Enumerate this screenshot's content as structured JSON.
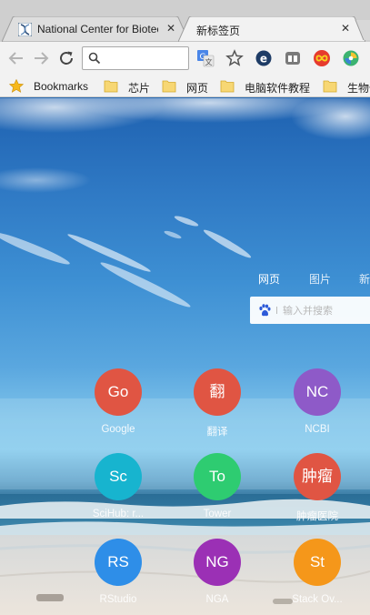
{
  "tabs": [
    {
      "title": "National Center for Biotechnology Information",
      "favicon": "ncbi-helix-icon",
      "close": "✕"
    },
    {
      "title": "新标签页",
      "close": "✕"
    }
  ],
  "toolbar": {
    "back": "back-arrow-icon",
    "forward": "forward-arrow-icon",
    "reload": "reload-icon",
    "omnibox_value": "",
    "extensions": [
      "translate-icon",
      "star-icon",
      "extension-e-icon",
      "extension-window-icon",
      "extension-infinity-icon",
      "extension-swirl-icon"
    ]
  },
  "bookmarks": [
    {
      "label": "Bookmarks",
      "icon": "star-bookmark-icon"
    },
    {
      "label": "芯片",
      "icon": "folder-icon"
    },
    {
      "label": "网页",
      "icon": "folder-icon"
    },
    {
      "label": "电脑软件教程",
      "icon": "folder-icon"
    },
    {
      "label": "生物信息",
      "icon": "folder-icon"
    }
  ],
  "ntp": {
    "search_tabs": [
      "网页",
      "图片",
      "新闻"
    ],
    "search_placeholder": "输入并搜索",
    "tiles": [
      {
        "abbr": "Go",
        "label": "Google",
        "color": "#e05543"
      },
      {
        "abbr": "翻",
        "label": "翻译",
        "color": "#e05543"
      },
      {
        "abbr": "NC",
        "label": "NCBI",
        "color": "#8e5ac8"
      },
      {
        "abbr": "Sc",
        "label": "SciHub: r...",
        "color": "#17b4cf"
      },
      {
        "abbr": "To",
        "label": "Tower",
        "color": "#2ecc71"
      },
      {
        "abbr": "肿瘤",
        "label": "肿瘤医院",
        "color": "#e05543"
      },
      {
        "abbr": "RS",
        "label": "RStudio",
        "color": "#2e8ee8"
      },
      {
        "abbr": "NG",
        "label": "NGA",
        "color": "#9b30b5"
      },
      {
        "abbr": "St",
        "label": "Stack Ov...",
        "color": "#f5971a"
      }
    ]
  }
}
